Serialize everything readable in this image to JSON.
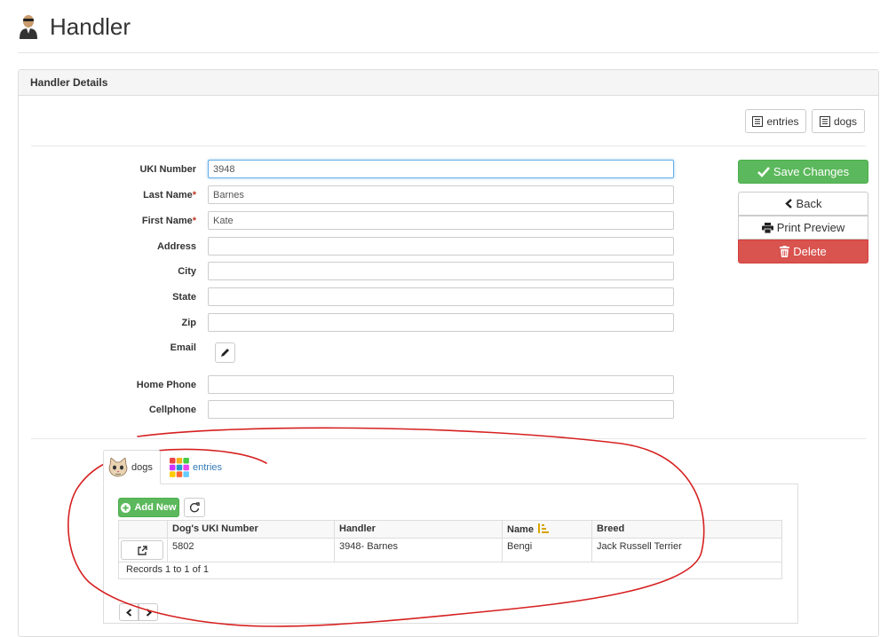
{
  "page": {
    "title": "Handler"
  },
  "panel": {
    "heading": "Handler Details"
  },
  "top_buttons": {
    "entries": "entries",
    "dogs": "dogs"
  },
  "form": {
    "fields": [
      {
        "label": "UKI Number",
        "required": false,
        "value": "3948",
        "focused": true
      },
      {
        "label": "Last Name",
        "required": true,
        "value": "Barnes"
      },
      {
        "label": "First Name",
        "required": true,
        "value": "Kate"
      },
      {
        "label": "Address",
        "required": false,
        "value": ""
      },
      {
        "label": "City",
        "required": false,
        "value": ""
      },
      {
        "label": "State",
        "required": false,
        "value": ""
      },
      {
        "label": "Zip",
        "required": false,
        "value": ""
      }
    ],
    "email": {
      "label": "Email"
    },
    "phones": [
      {
        "label": "Home Phone",
        "value": ""
      },
      {
        "label": "Cellphone",
        "value": ""
      }
    ],
    "required_marker": "*"
  },
  "actions": {
    "save": "Save Changes",
    "back": "Back",
    "print": "Print Preview",
    "delete": "Delete"
  },
  "tabs": [
    {
      "label": "dogs",
      "active": true
    },
    {
      "label": "entries",
      "active": false
    }
  ],
  "grid": {
    "add_new": "Add New",
    "columns": [
      "Dog's UKI Number",
      "Handler",
      "Name",
      "Breed"
    ],
    "rows": [
      {
        "uki": "5802",
        "handler": "3948- Barnes",
        "name": "Bengi",
        "breed": "Jack Russell Terrier"
      }
    ],
    "records_text": "Records 1 to 1 of 1"
  },
  "colors": {
    "success": "#5cb85c",
    "danger": "#d9534f",
    "link": "#337ab7",
    "annotation": "#d62020"
  }
}
